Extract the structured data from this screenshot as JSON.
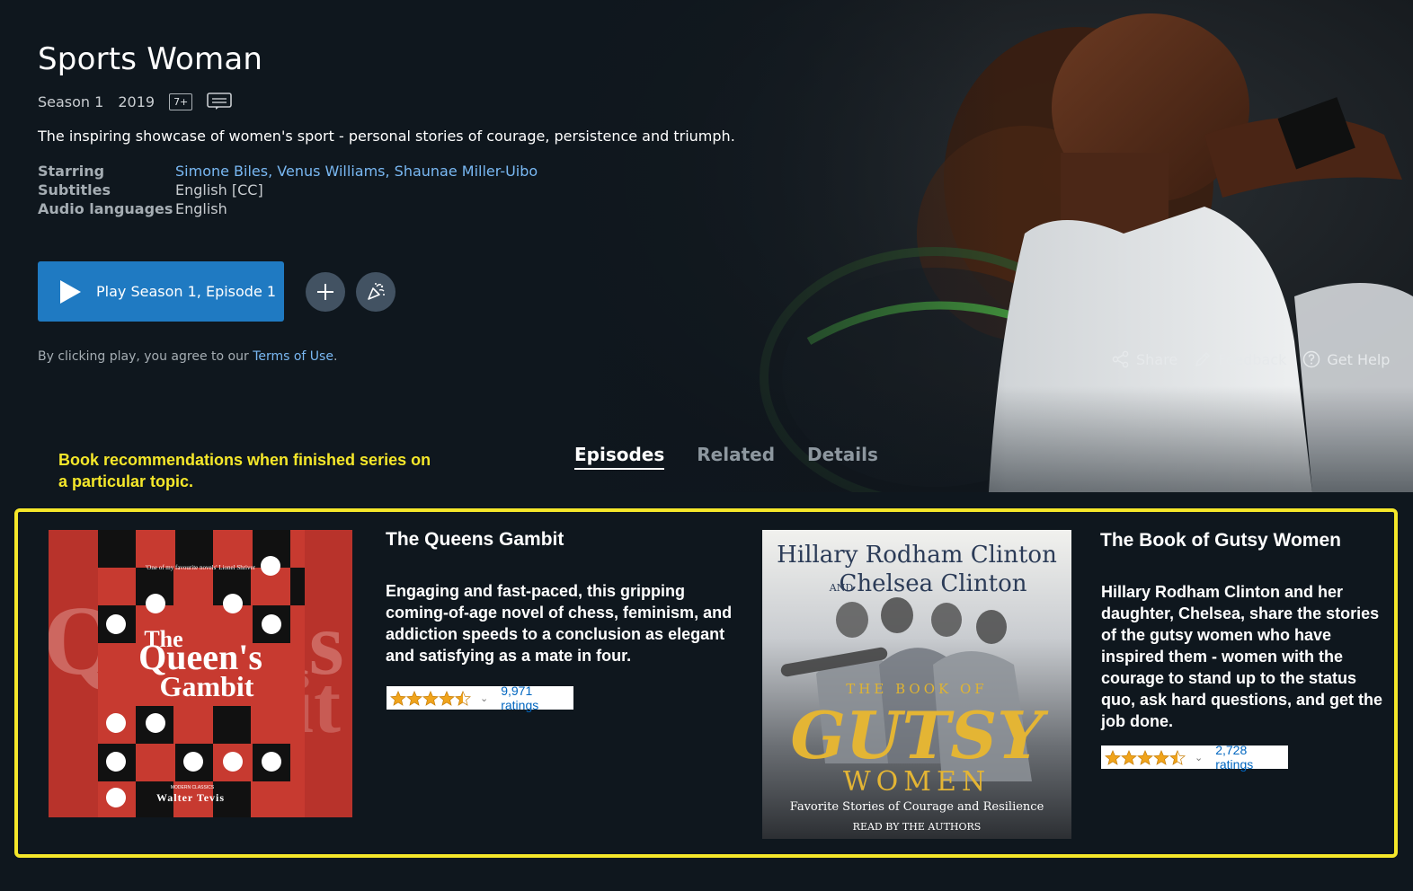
{
  "show": {
    "title": "Sports Woman",
    "season": "Season 1",
    "year": "2019",
    "maturity_rating": "7+",
    "synopsis": "The inspiring showcase of women's sport - personal stories of courage, persistence and triumph.",
    "details": {
      "starring_label": "Starring",
      "starring_value": "Simone Biles, Venus Williams, Shaunae Miller-Uibo",
      "subtitles_label": "Subtitles",
      "subtitles_value": "English [CC]",
      "audio_label": "Audio languages",
      "audio_value": "English"
    }
  },
  "buttons": {
    "play_label": "Play Season 1, Episode 1"
  },
  "terms": {
    "prefix": "By clicking play, you agree to our ",
    "link": "Terms of Use",
    "suffix": "."
  },
  "actions": {
    "share": "Share",
    "feedback": "Feedback",
    "help": "Get Help"
  },
  "annotation": "Book recommendations when finished series on a particular topic.",
  "tabs": [
    {
      "label": "Episodes",
      "active": true
    },
    {
      "label": "Related",
      "active": false
    },
    {
      "label": "Details",
      "active": false
    }
  ],
  "books": [
    {
      "title": "The Queens Gambit",
      "description": "Engaging and fast-paced, this gripping coming-of-age novel of chess, feminism, and addiction speeds to a conclusion as elegant and satisfying as a mate in four.",
      "rating_stars": 4.5,
      "ratings_count": "9,971 ratings",
      "cover": {
        "quote": "'One of my favourite novels' Lionel Shriver",
        "the": "The",
        "word1": "Queen's",
        "word2": "Gambit",
        "series": "MODERN CLASSICS",
        "author": "Walter Tevis"
      }
    },
    {
      "title": "The Book of Gutsy Women",
      "description": "Hillary Rodham Clinton and her daughter, Chelsea, share the stories of the gutsy women who have inspired them - women with the courage to stand up to the status quo, ask hard questions, and get the job done.",
      "rating_stars": 4.5,
      "ratings_count": "2,728 ratings",
      "cover": {
        "author1": "Hillary Rodham Clinton",
        "and": "AND",
        "author2": "Chelsea Clinton",
        "kicker": "THE BOOK OF",
        "word1": "GUTSY",
        "word2": "WOMEN",
        "tagline": "Favorite Stories of Courage and Resilience",
        "read_by": "READ BY THE AUTHORS"
      }
    }
  ],
  "colors": {
    "background": "#0f171e",
    "play_button": "#1f7ac2",
    "link": "#79b8f3",
    "highlight": "#f5e72a",
    "star": "#f0a41c"
  }
}
